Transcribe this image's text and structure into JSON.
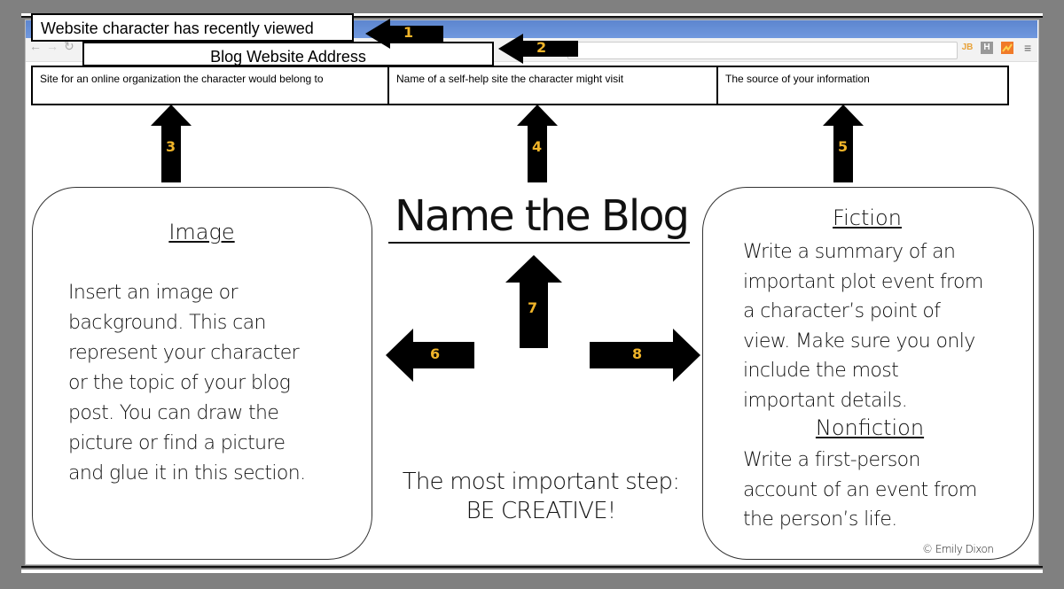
{
  "browser": {
    "nav_icons": [
      "back-arrow-icon",
      "forward-arrow-icon",
      "reload-icon"
    ],
    "extensions": [
      {
        "name": "jb-extension-icon",
        "label": "JB",
        "color": "#e8a33a"
      },
      {
        "name": "h-extension-icon",
        "label": "H",
        "color": "#999999"
      },
      {
        "name": "analytics-extension-icon",
        "label": "",
        "color": "#f07a2a"
      }
    ],
    "menu_icon": "hamburger-menu-icon"
  },
  "labels": {
    "recently_viewed": "Website character has recently viewed",
    "blog_address": "Blog Website Address"
  },
  "cells": [
    "Site for an online organization the character would belong to",
    "Name of a self-help site the character might visit",
    "The source of your information"
  ],
  "arrows": {
    "n1": "1",
    "n2": "2",
    "n3": "3",
    "n4": "4",
    "n5": "5",
    "n6": "6",
    "n7": "7",
    "n8": "8"
  },
  "title": "Name the Blog",
  "image_box": {
    "heading": "Image",
    "lines": [
      "Insert an image or",
      "background.  This can",
      "represent your character",
      "or the topic of your blog",
      "post.  You can draw the",
      "picture or find a picture",
      "and glue it in this section."
    ]
  },
  "fiction_box": {
    "fiction_heading": "Fiction",
    "fiction_lines": [
      "Write a summary of an",
      "important plot event from",
      "a character’s point of",
      "view.  Make sure you only",
      "include the most",
      "important details."
    ],
    "nonfiction_heading": "Nonfiction",
    "nonfiction_lines": [
      "Write a first-person",
      "account of an event from",
      "the person’s life."
    ],
    "copyright": "© Emily Dixon"
  },
  "creative": {
    "line1": "The most important step:",
    "line2": "BE CREATIVE!"
  },
  "colors": {
    "number_label": "#f0b429",
    "titlebar": "#6690d8"
  }
}
